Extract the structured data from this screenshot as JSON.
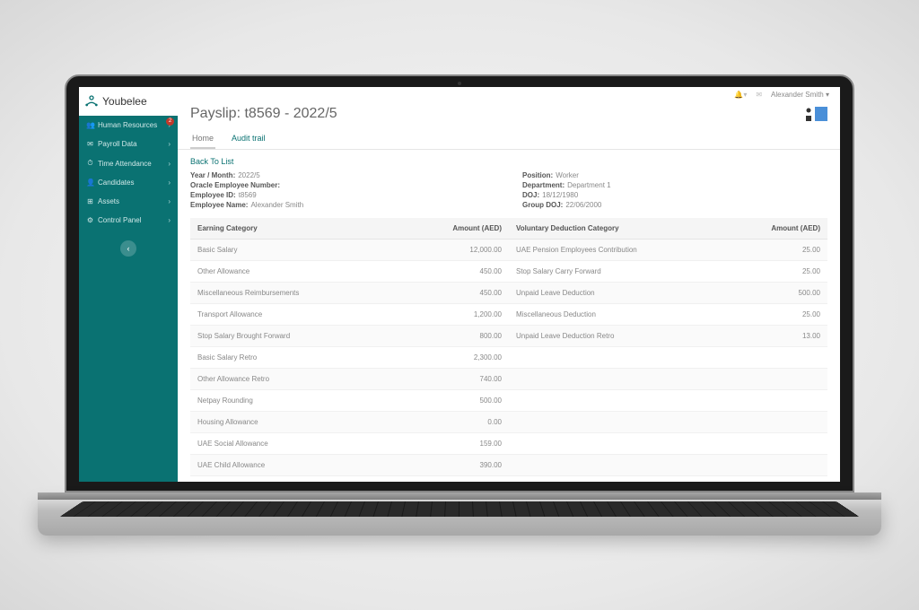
{
  "brand": {
    "name": "Youbelee"
  },
  "topbar": {
    "user": "Alexander Smith"
  },
  "sidebar": {
    "items": [
      {
        "label": "Human Resources",
        "icon": "👥",
        "badge": "2"
      },
      {
        "label": "Payroll Data",
        "icon": "✉"
      },
      {
        "label": "Time Attendance",
        "icon": "⏱"
      },
      {
        "label": "Candidates",
        "icon": "👤"
      },
      {
        "label": "Assets",
        "icon": "⊞"
      },
      {
        "label": "Control Panel",
        "icon": "⚙"
      }
    ]
  },
  "page": {
    "title": "Payslip: t8569 - 2022/5"
  },
  "tabs": {
    "home": "Home",
    "audit": "Audit trail"
  },
  "back_link": "Back To List",
  "details": {
    "year_month_label": "Year / Month:",
    "year_month_value": "2022/5",
    "oracle_label": "Oracle Employee Number:",
    "oracle_value": "",
    "emp_id_label": "Employee ID:",
    "emp_id_value": "t8569",
    "emp_name_label": "Employee Name:",
    "emp_name_value": "Alexander Smith",
    "position_label": "Position:",
    "position_value": "Worker",
    "department_label": "Department:",
    "department_value": "Department 1",
    "doj_label": "DOJ:",
    "doj_value": "18/12/1980",
    "group_doj_label": "Group DOJ:",
    "group_doj_value": "22/06/2000"
  },
  "earnings": {
    "header_category": "Earning Category",
    "header_amount": "Amount (AED)",
    "rows": [
      {
        "cat": "Basic Salary",
        "amt": "12,000.00"
      },
      {
        "cat": "Other Allowance",
        "amt": "450.00"
      },
      {
        "cat": "Miscellaneous Reimbursements",
        "amt": "450.00"
      },
      {
        "cat": "Transport Allowance",
        "amt": "1,200.00"
      },
      {
        "cat": "Stop Salary Brought Forward",
        "amt": "800.00"
      },
      {
        "cat": "Basic Salary Retro",
        "amt": "2,300.00"
      },
      {
        "cat": "Other Allowance Retro",
        "amt": "740.00"
      },
      {
        "cat": "Netpay Rounding",
        "amt": "500.00"
      },
      {
        "cat": "Housing Allowance",
        "amt": "0.00"
      },
      {
        "cat": "UAE Social Allowance",
        "amt": "159.00"
      },
      {
        "cat": "UAE Child Allowance",
        "amt": "390.00"
      }
    ]
  },
  "deductions": {
    "header_category": "Voluntary Deduction Category",
    "header_amount": "Amount (AED)",
    "rows": [
      {
        "cat": "UAE Pension Employees Contribution",
        "amt": "25.00"
      },
      {
        "cat": "Stop Salary Carry Forward",
        "amt": "25.00"
      },
      {
        "cat": "Unpaid Leave Deduction",
        "amt": "500.00"
      },
      {
        "cat": "Miscellaneous Deduction",
        "amt": "25.00"
      },
      {
        "cat": "Unpaid Leave Deduction Retro",
        "amt": "13.00"
      },
      {
        "cat": "",
        "amt": ""
      },
      {
        "cat": "",
        "amt": ""
      },
      {
        "cat": "",
        "amt": ""
      },
      {
        "cat": "",
        "amt": ""
      },
      {
        "cat": "",
        "amt": ""
      },
      {
        "cat": "",
        "amt": ""
      }
    ]
  }
}
